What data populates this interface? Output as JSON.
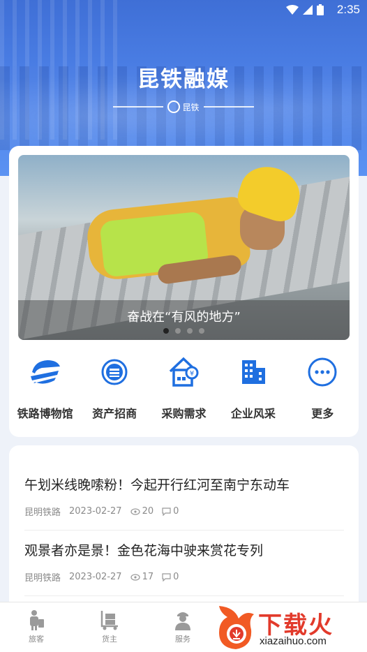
{
  "status_bar": {
    "time": "2:35"
  },
  "header": {
    "title": "昆铁融媒",
    "logo_text": "昆铁"
  },
  "banner": {
    "caption": "奋战在“有风的地方”",
    "slide_count": 4,
    "active_index": 0
  },
  "shortcuts": [
    {
      "label": "铁路博物馆",
      "icon": "museum-icon"
    },
    {
      "label": "资产招商",
      "icon": "coin-icon"
    },
    {
      "label": "采购需求",
      "icon": "house-yen-icon"
    },
    {
      "label": "企业风采",
      "icon": "building-icon"
    },
    {
      "label": "更多",
      "icon": "more-icon"
    }
  ],
  "news": [
    {
      "title": "午划米线晚嗦粉！今起开行红河至南宁东动车",
      "source": "昆明铁路",
      "date": "2023-02-27",
      "views": "20",
      "comments": "0"
    },
    {
      "title": "观景者亦是景！金色花海中驶来赏花专列",
      "source": "昆明铁路",
      "date": "2023-02-27",
      "views": "17",
      "comments": "0"
    }
  ],
  "bottom_nav": [
    {
      "label": "旅客",
      "icon": "passenger-icon"
    },
    {
      "label": "货主",
      "icon": "cargo-icon"
    },
    {
      "label": "服务",
      "icon": "service-icon"
    }
  ],
  "watermark": {
    "text": "下载火",
    "url": "xiazaihuo.com"
  },
  "colors": {
    "primary": "#1f6fe0",
    "header_blue": "#4f84ea",
    "watermark_red": "#e23a2b"
  }
}
